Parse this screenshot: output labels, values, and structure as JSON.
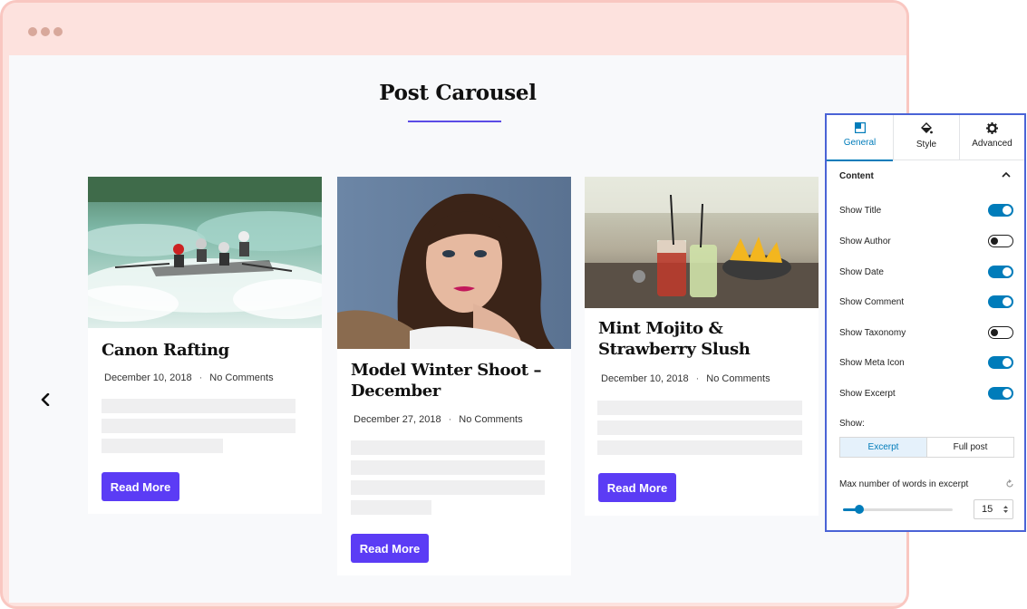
{
  "page": {
    "title": "Post Carousel"
  },
  "posts": [
    {
      "title": "Canon Rafting",
      "date": "December 10, 2018",
      "separator": "·",
      "comments": "No Comments",
      "button": "Read More",
      "image": "rafting-photo"
    },
    {
      "title": "Model Winter Shoot – December",
      "date": "December 27, 2018",
      "separator": "·",
      "comments": "No Comments",
      "button": "Read More",
      "image": "portrait-photo"
    },
    {
      "title": "Mint Mojito & Strawberry Slush",
      "date": "December 10, 2018",
      "separator": "·",
      "comments": "No Comments",
      "button": "Read More",
      "image": "cocktail-photo"
    }
  ],
  "panel": {
    "tabs": [
      {
        "label": "General",
        "icon": "general-icon",
        "active": true
      },
      {
        "label": "Style",
        "icon": "paint-bucket-icon",
        "active": false
      },
      {
        "label": "Advanced",
        "icon": "gear-icon",
        "active": false
      }
    ],
    "section_title": "Content",
    "options": [
      {
        "label": "Show Title",
        "on": true
      },
      {
        "label": "Show Author",
        "on": false
      },
      {
        "label": "Show Date",
        "on": true
      },
      {
        "label": "Show Comment",
        "on": true
      },
      {
        "label": "Show Taxonomy",
        "on": false
      },
      {
        "label": "Show Meta Icon",
        "on": true
      },
      {
        "label": "Show Excerpt",
        "on": true
      }
    ],
    "show_label": "Show:",
    "show_options": [
      "Excerpt",
      "Full post"
    ],
    "show_selected": "Excerpt",
    "words_label": "Max number of words in excerpt",
    "words_value": "15",
    "words_slider_fraction": 0.15
  },
  "colors": {
    "accent": "#5b3cf5",
    "panel_accent": "#007cba",
    "frame": "#fde2de"
  }
}
